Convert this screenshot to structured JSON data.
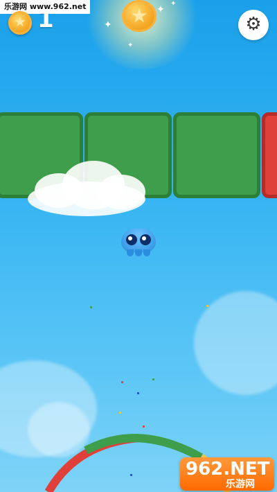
{
  "watermark": {
    "top_text": "乐游网 www.962.net",
    "logo_text": "962.NET",
    "logo_sub": "乐游网"
  },
  "hud": {
    "score": "1",
    "coin_icon": "coin-star-icon",
    "settings_icon": "gear-icon"
  },
  "blocks": {
    "colors": [
      "#3e9e4c",
      "#3e9e4c",
      "#3e9e4c",
      "#e0403a"
    ]
  },
  "ring": {
    "colors": [
      "#e0403a",
      "#3e9e4c",
      "#f5c542"
    ]
  },
  "theme": {
    "sky_top": "#1aa0ea",
    "sky_bottom": "#7fd3f7",
    "player": "#2a8ee0"
  }
}
